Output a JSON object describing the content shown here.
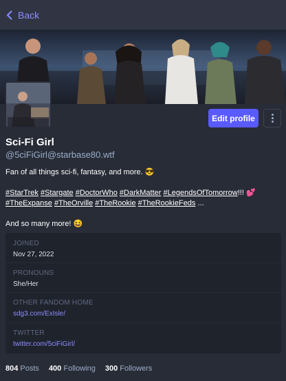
{
  "nav": {
    "back_label": "Back"
  },
  "profile": {
    "display_name": "Sci-Fi Girl",
    "handle": "@5ciFiGirl@starbase80.wtf",
    "edit_label": "Edit profile"
  },
  "bio": {
    "line1": "Fan of all things sci-fi, fantasy, and more.",
    "line1_emoji": "😎",
    "hashtags": [
      "#StarTrek",
      "#Stargate",
      "#DoctorWho",
      "#DarkMatter",
      "#LegendsOfTomorrow",
      "#TheExpanse",
      "#TheOrville",
      "#TheRookie",
      "#TheRookieFeds"
    ],
    "after_legends": "!!!",
    "heart_emoji": "💕",
    "ellipsis": "...",
    "line3": "And so many more!",
    "line3_emoji": "😆"
  },
  "fields": [
    {
      "label": "JOINED",
      "value": "Nov 27, 2022",
      "is_link": false
    },
    {
      "label": "PRONOUNS",
      "value": "She/Her",
      "is_link": false
    },
    {
      "label": "OTHER FANDOM HOME",
      "value": "sdg3.com/ExIsle/",
      "is_link": true
    },
    {
      "label": "TWITTER",
      "value": "twitter.com/5ciFiGirl/",
      "is_link": true
    }
  ],
  "stats": {
    "posts_count": "804",
    "posts_label": "Posts",
    "following_count": "400",
    "following_label": "Following",
    "followers_count": "300",
    "followers_label": "Followers"
  },
  "colors": {
    "background": "#282c37",
    "accent": "#595aff",
    "link": "#8c8dff",
    "muted": "#9baec8"
  },
  "icons": {
    "back": "chevron-left-icon",
    "more": "vertical-ellipsis-icon"
  }
}
